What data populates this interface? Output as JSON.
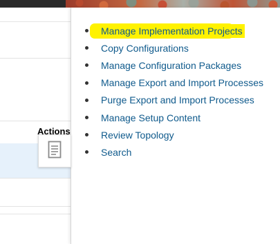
{
  "header": {
    "banner_icon": "decorative-pattern"
  },
  "table": {
    "actions_header": "Actions",
    "actions_icon": "document-icon"
  },
  "menu": {
    "items": [
      {
        "label": "Manage Implementation Projects",
        "highlighted": true
      },
      {
        "label": "Copy Configurations"
      },
      {
        "label": "Manage Configuration Packages"
      },
      {
        "label": "Manage Export and Import Processes"
      },
      {
        "label": "Purge Export and Import Processes"
      },
      {
        "label": "Manage Setup Content"
      },
      {
        "label": "Review Topology"
      },
      {
        "label": "Search"
      }
    ]
  },
  "colors": {
    "link": "#0f5a8c",
    "highlight": "#fff200",
    "selected_row": "#e6f1fb"
  }
}
